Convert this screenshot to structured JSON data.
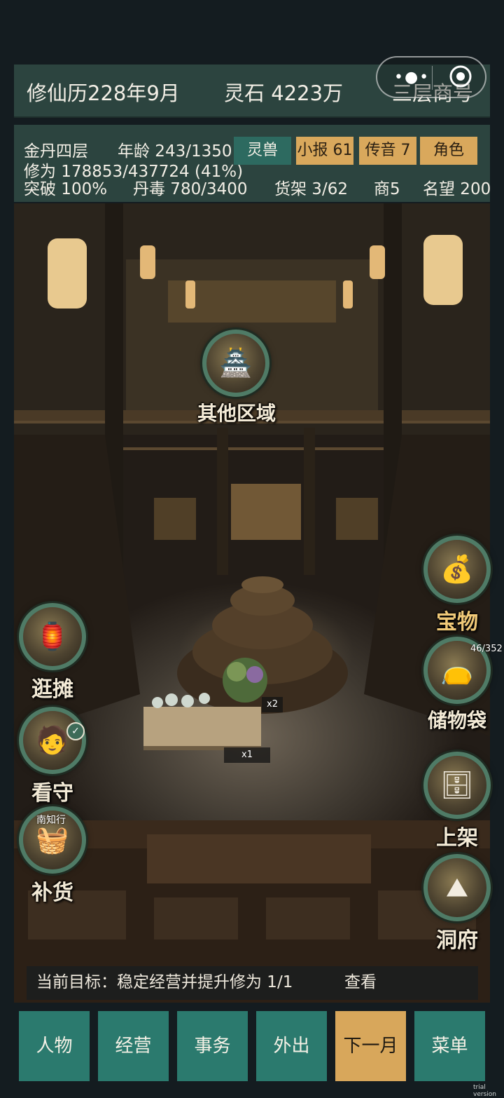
{
  "header": {
    "date": "修仙历228年9月",
    "spirit_stone": "灵石 4223万",
    "shop_level": "三层商号"
  },
  "capsule": {
    "more_icon": "more-dots-icon",
    "close_icon": "target-icon"
  },
  "stats": {
    "realm": "金丹四层",
    "age": "年龄 243/1350",
    "cultivation": "修为 178853/437724 (41%)",
    "breakthrough": "突破 100%",
    "pill_toxin": "丹毒 780/3400",
    "shelves": "货架 3/62",
    "merchants": "商5",
    "reputation": "名望 200"
  },
  "tags": {
    "beast": "灵兽",
    "news": "小报 61",
    "message": "传音 7",
    "role": "角色"
  },
  "hotspots": {
    "other_areas": "其他区域",
    "stall": "逛摊",
    "guard": "看守",
    "restock": "补货",
    "restock_supplier": "南知行",
    "treasure": "宝物",
    "storage_bag": "储物袋",
    "storage_count": "46/352",
    "list_goods": "上架",
    "cave": "洞府"
  },
  "scene": {
    "qty_a": "x2",
    "qty_b": "x1"
  },
  "goal": {
    "text": "当前目标：稳定经营并提升修为 1/1",
    "view": "查看"
  },
  "nav": {
    "character": "人物",
    "business": "经营",
    "affairs": "事务",
    "outing": "外出",
    "next_month": "下一月",
    "menu": "菜单"
  },
  "watermark": "trial version",
  "colors": {
    "panel": "#2c443f",
    "nav_teal": "#2b7a6e",
    "nav_gold": "#d8a75b",
    "tag_teal": "#2d6a60",
    "tag_gold": "#d9a85c"
  }
}
